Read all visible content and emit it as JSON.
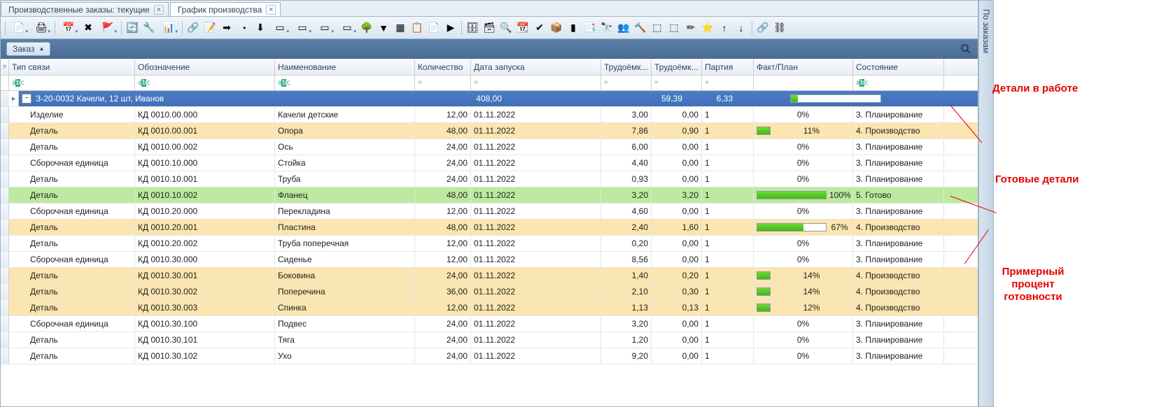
{
  "tabs": [
    {
      "label": "Производственные заказы: текущие",
      "active": false
    },
    {
      "label": "График производства",
      "active": true
    }
  ],
  "orderButton": "Заказ",
  "columns": {
    "type": "Тип связи",
    "desig": "Обозначение",
    "name": "Наименование",
    "qty": "Количество",
    "date": "Дата запуска",
    "labor1": "Трудоёмк...",
    "labor2": "Трудоёмк...",
    "batch": "Партия",
    "plan": "Факт/План",
    "state": "Состояние"
  },
  "filters": {
    "eq": "=",
    "abc": "abc"
  },
  "group": {
    "label": "З-20-0032 Качели, 12 шт, Иванов",
    "qty": "408,00",
    "labor1": "59,39",
    "labor2": "6,33"
  },
  "rows": [
    {
      "type": "Изделие",
      "desig": "КД 0010.00.000",
      "name": "Качели детские",
      "qty": "12,00",
      "date": "01.11.2022",
      "l1": "3,00",
      "l2": "0,00",
      "batch": "1",
      "pct": 0,
      "pctLabel": "0%",
      "state": "3. Планирование",
      "cls": ""
    },
    {
      "type": "Деталь",
      "desig": "КД 0010.00.001",
      "name": "Опора",
      "qty": "48,00",
      "date": "01.11.2022",
      "l1": "7,86",
      "l2": "0,90",
      "batch": "1",
      "pct": 11,
      "pctLabel": "11%",
      "state": "4. Производство",
      "cls": "yellow"
    },
    {
      "type": "Деталь",
      "desig": "КД 0010.00.002",
      "name": "Ось",
      "qty": "24,00",
      "date": "01.11.2022",
      "l1": "6,00",
      "l2": "0,00",
      "batch": "1",
      "pct": 0,
      "pctLabel": "0%",
      "state": "3. Планирование",
      "cls": ""
    },
    {
      "type": "Сборочная единица",
      "desig": "КД 0010.10.000",
      "name": "Стойка",
      "qty": "24,00",
      "date": "01.11.2022",
      "l1": "4,40",
      "l2": "0,00",
      "batch": "1",
      "pct": 0,
      "pctLabel": "0%",
      "state": "3. Планирование",
      "cls": ""
    },
    {
      "type": "Деталь",
      "desig": "КД 0010.10.001",
      "name": "Труба",
      "qty": "24,00",
      "date": "01.11.2022",
      "l1": "0,93",
      "l2": "0,00",
      "batch": "1",
      "pct": 0,
      "pctLabel": "0%",
      "state": "3. Планирование",
      "cls": ""
    },
    {
      "type": "Деталь",
      "desig": "КД 0010.10.002",
      "name": "Фланец",
      "qty": "48,00",
      "date": "01.11.2022",
      "l1": "3,20",
      "l2": "3,20",
      "batch": "1",
      "pct": 100,
      "pctLabel": "100%",
      "state": "5. Готово",
      "cls": "green"
    },
    {
      "type": "Сборочная единица",
      "desig": "КД 0010.20.000",
      "name": "Перекладина",
      "qty": "12,00",
      "date": "01.11.2022",
      "l1": "4,60",
      "l2": "0,00",
      "batch": "1",
      "pct": 0,
      "pctLabel": "0%",
      "state": "3. Планирование",
      "cls": ""
    },
    {
      "type": "Деталь",
      "desig": "КД 0010.20.001",
      "name": "Пластина",
      "qty": "48,00",
      "date": "01.11.2022",
      "l1": "2,40",
      "l2": "1,60",
      "batch": "1",
      "pct": 67,
      "pctLabel": "67%",
      "state": "4. Производство",
      "cls": "yellow"
    },
    {
      "type": "Деталь",
      "desig": "КД 0010.20.002",
      "name": "Труба поперечная",
      "qty": "12,00",
      "date": "01.11.2022",
      "l1": "0,20",
      "l2": "0,00",
      "batch": "1",
      "pct": 0,
      "pctLabel": "0%",
      "state": "3. Планирование",
      "cls": ""
    },
    {
      "type": "Сборочная единица",
      "desig": "КД 0010.30.000",
      "name": "Сиденье",
      "qty": "12,00",
      "date": "01.11.2022",
      "l1": "8,56",
      "l2": "0,00",
      "batch": "1",
      "pct": 0,
      "pctLabel": "0%",
      "state": "3. Планирование",
      "cls": ""
    },
    {
      "type": "Деталь",
      "desig": "КД 0010.30.001",
      "name": "Боковина",
      "qty": "24,00",
      "date": "01.11.2022",
      "l1": "1,40",
      "l2": "0,20",
      "batch": "1",
      "pct": 14,
      "pctLabel": "14%",
      "state": "4. Производство",
      "cls": "yellow"
    },
    {
      "type": "Деталь",
      "desig": "КД 0010.30.002",
      "name": "Поперечина",
      "qty": "36,00",
      "date": "01.11.2022",
      "l1": "2,10",
      "l2": "0,30",
      "batch": "1",
      "pct": 14,
      "pctLabel": "14%",
      "state": "4. Производство",
      "cls": "yellow"
    },
    {
      "type": "Деталь",
      "desig": "КД 0010.30.003",
      "name": "Спинка",
      "qty": "12,00",
      "date": "01.11.2022",
      "l1": "1,13",
      "l2": "0,13",
      "batch": "1",
      "pct": 12,
      "pctLabel": "12%",
      "state": "4. Производство",
      "cls": "yellow"
    },
    {
      "type": "Сборочная единица",
      "desig": "КД 0010.30.100",
      "name": "Подвес",
      "qty": "24,00",
      "date": "01.11.2022",
      "l1": "3,20",
      "l2": "0,00",
      "batch": "1",
      "pct": 0,
      "pctLabel": "0%",
      "state": "3. Планирование",
      "cls": ""
    },
    {
      "type": "Деталь",
      "desig": "КД 0010.30.101",
      "name": "Тяга",
      "qty": "24,00",
      "date": "01.11.2022",
      "l1": "1,20",
      "l2": "0,00",
      "batch": "1",
      "pct": 0,
      "pctLabel": "0%",
      "state": "3. Планирование",
      "cls": ""
    },
    {
      "type": "Деталь",
      "desig": "КД 0010.30.102",
      "name": "Ухо",
      "qty": "24,00",
      "date": "01.11.2022",
      "l1": "9,20",
      "l2": "0,00",
      "batch": "1",
      "pct": 0,
      "pctLabel": "0%",
      "state": "3. Планирование",
      "cls": ""
    }
  ],
  "sideTab": "По заказам",
  "annotations": {
    "a1": "Детали в работе",
    "a2": "Готовые детали",
    "a3": "Примерный процент готовности"
  },
  "icons": [
    "new",
    "print",
    "sep",
    "calendar",
    "delete",
    "flag",
    "sep",
    "refresh",
    "wrench",
    "excel",
    "sep",
    "share",
    "note",
    "import",
    "pie",
    "download",
    "span",
    "span",
    "span",
    "span",
    "tree",
    "funnel",
    "grid3",
    "form",
    "form2",
    "run",
    "sep",
    "db",
    "db2",
    "search",
    "cal2",
    "check",
    "cube",
    "barcode",
    "report",
    "binoc",
    "users",
    "hammer",
    "org",
    "org2",
    "pencil",
    "star",
    "up",
    "down",
    "sep",
    "link",
    "unlink"
  ]
}
